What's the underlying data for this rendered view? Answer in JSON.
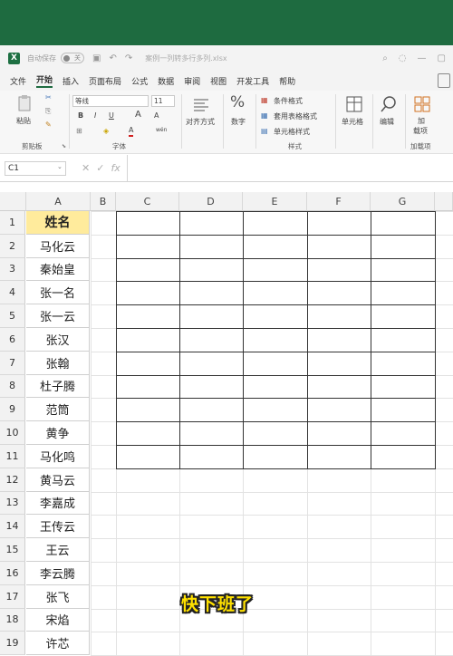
{
  "titlebar": {
    "logo": "X",
    "autosave_label": "自动保存",
    "autosave_state": "关",
    "filename": "案例一列转多行多列.xlsx",
    "icons": [
      "save-icon",
      "undo-icon",
      "redo-icon"
    ]
  },
  "menu": {
    "items": [
      "文件",
      "开始",
      "插入",
      "页面布局",
      "公式",
      "数据",
      "审阅",
      "视图",
      "开发工具",
      "帮助"
    ],
    "active": "开始"
  },
  "ribbon": {
    "clipboard": {
      "paste": "粘贴",
      "label": "剪贴板"
    },
    "font": {
      "name": "等线",
      "size": "11",
      "label": "字体",
      "bold": "B",
      "italic": "I",
      "underline": "U",
      "grow": "A",
      "shrink": "A",
      "color_a": "A",
      "wen": "wén"
    },
    "align": {
      "label": "对齐方式"
    },
    "number": {
      "label": "数字",
      "symbol": "%"
    },
    "styles": {
      "cond": "条件格式",
      "table": "套用表格格式",
      "cell": "单元格样式",
      "label": "样式"
    },
    "cells": {
      "label": "单元格"
    },
    "edit": {
      "label": "编辑"
    },
    "addins": {
      "btn1": "加",
      "btn2": "载项",
      "label": "加载项"
    }
  },
  "formula_bar": {
    "name_box": "C1",
    "fx": "fx",
    "content": ""
  },
  "columns": [
    "A",
    "B",
    "C",
    "D",
    "E",
    "F",
    "G"
  ],
  "rows": [
    "1",
    "2",
    "3",
    "4",
    "5",
    "6",
    "7",
    "8",
    "9",
    "10",
    "11",
    "12",
    "13",
    "14",
    "15",
    "16",
    "17",
    "18",
    "19"
  ],
  "column_a": [
    "姓名",
    "马化云",
    "秦始皇",
    "张一名",
    "张一云",
    "张汉",
    "张翰",
    "杜子腾",
    "范筒",
    "黄争",
    "马化鸣",
    "黄马云",
    "李嘉成",
    "王传云",
    "王云",
    "李云腾",
    "张飞",
    "宋焰",
    "许芯"
  ],
  "subtitle": "快下班了",
  "colors": {
    "excel_green": "#1e6b40",
    "header_fill": "#ffeb9c",
    "subtitle": "#ffe100"
  }
}
